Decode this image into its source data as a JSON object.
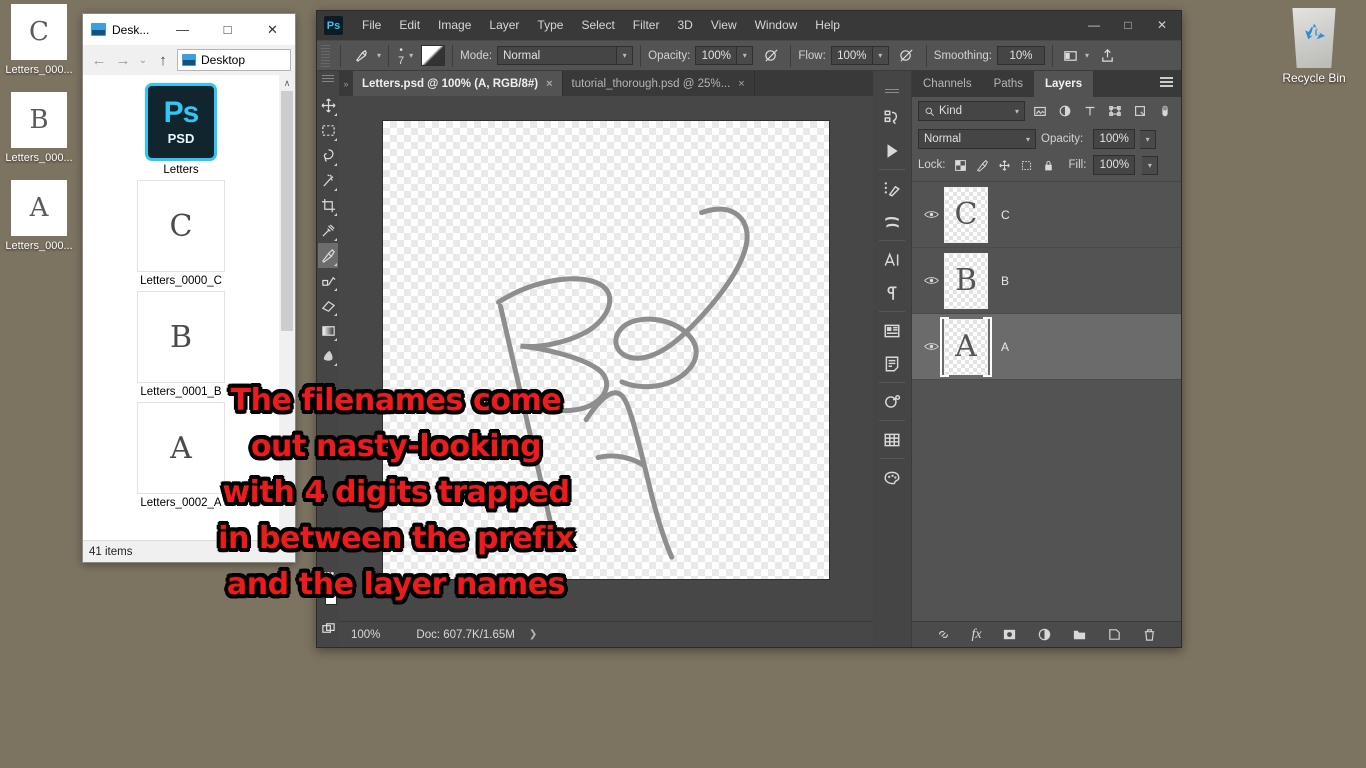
{
  "desktop": {
    "background_color": "#7d7361",
    "icons": [
      {
        "label": "Letters_000...",
        "glyph": "C",
        "name": "desktop-icon-letters-c"
      },
      {
        "label": "Letters_000...",
        "glyph": "B",
        "name": "desktop-icon-letters-b"
      },
      {
        "label": "Letters_000...",
        "glyph": "A",
        "name": "desktop-icon-letters-a"
      }
    ],
    "recycle_bin": {
      "label": "Recycle Bin"
    }
  },
  "explorer": {
    "title": "Desk...",
    "window_buttons": {
      "minimize": "—",
      "maximize": "□",
      "close": "✕"
    },
    "nav": {
      "back": "←",
      "forward": "→",
      "recent": "⌄",
      "up": "↑"
    },
    "address": "Desktop",
    "scroll_up": "∧",
    "files": [
      {
        "name": "Letters",
        "type": "psd",
        "ps_label": "Ps",
        "psd_label": "PSD"
      },
      {
        "name": "Letters_0000_C",
        "type": "png",
        "glyph": "C"
      },
      {
        "name": "Letters_0001_B",
        "type": "png",
        "glyph": "B"
      },
      {
        "name": "Letters_0002_A",
        "type": "png",
        "glyph": "A"
      }
    ],
    "status": "41 items"
  },
  "photoshop": {
    "logo": "Ps",
    "menus": [
      "File",
      "Edit",
      "Image",
      "Layer",
      "Type",
      "Select",
      "Filter",
      "3D",
      "View",
      "Window",
      "Help"
    ],
    "window_buttons": {
      "minimize": "—",
      "maximize": "□",
      "close": "✕"
    },
    "options_bar": {
      "brush_size": "7",
      "mode_label": "Mode:",
      "mode_value": "Normal",
      "opacity_label": "Opacity:",
      "opacity_value": "100%",
      "flow_label": "Flow:",
      "flow_value": "100%",
      "smoothing_label": "Smoothing:",
      "smoothing_value": "10%"
    },
    "tabs": [
      {
        "label": "Letters.psd @ 100% (A, RGB/8#)",
        "active": true,
        "close": "×"
      },
      {
        "label": "tutorial_thorough.psd @ 25%...",
        "active": false,
        "close": "×"
      }
    ],
    "tools": [
      "move-tool",
      "rectangular-marquee-tool",
      "lasso-tool",
      "magic-wand-tool",
      "crop-tool",
      "eyedropper-tool",
      "brush-tool",
      "clone-stamp-tool",
      "eraser-tool",
      "gradient-tool",
      "blur-tool",
      "more-tools"
    ],
    "selected_tool": "brush-tool",
    "status_bar": {
      "zoom": "100%",
      "doc_info": "Doc: 607.7K/1.65M",
      "expand": "❯"
    },
    "rail_icons": [
      "history-icon",
      "actions-play-icon",
      "brush-settings-icon",
      "brush-presets-icon",
      "character-icon",
      "paragraph-icon",
      "adjustments-icon",
      "properties-icon",
      "3d-icon",
      "swatches-grid-icon",
      "color-palette-icon"
    ],
    "layers_panel": {
      "tabs": [
        {
          "label": "Channels",
          "active": false
        },
        {
          "label": "Paths",
          "active": false
        },
        {
          "label": "Layers",
          "active": true
        }
      ],
      "filter_label": "Kind",
      "blend_mode": "Normal",
      "opacity_label": "Opacity:",
      "opacity_value": "100%",
      "lock_label": "Lock:",
      "fill_label": "Fill:",
      "fill_value": "100%",
      "layers": [
        {
          "name": "C",
          "visible": true,
          "selected": false,
          "glyph": "C"
        },
        {
          "name": "B",
          "visible": true,
          "selected": false,
          "glyph": "B"
        },
        {
          "name": "A",
          "visible": true,
          "selected": true,
          "glyph": "A"
        }
      ],
      "footer_icons": [
        "link-layers-icon",
        "layer-style-fx-icon",
        "add-mask-icon",
        "adjustment-layer-icon",
        "new-group-icon",
        "new-layer-icon",
        "delete-layer-icon"
      ]
    }
  },
  "annotation": {
    "color": "#ec1c1c",
    "lines": [
      "The filenames come",
      "out nasty-looking",
      "with 4 digits trapped",
      "in between the prefix",
      "and the layer names"
    ]
  }
}
